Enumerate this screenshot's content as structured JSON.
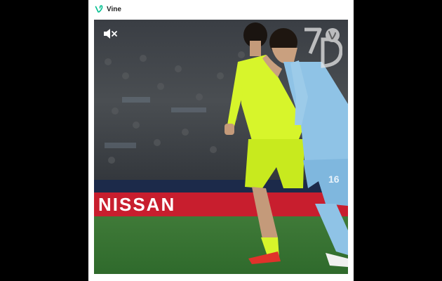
{
  "app": {
    "title": "Vine",
    "icon": "vine-logo-icon",
    "brand_color": "#00bf8f"
  },
  "video": {
    "mute_icon": "speaker-muted-icon",
    "watermark_icon": "vine-watermark-icon",
    "advertising_text": "NISSAN",
    "player_number": "16"
  }
}
